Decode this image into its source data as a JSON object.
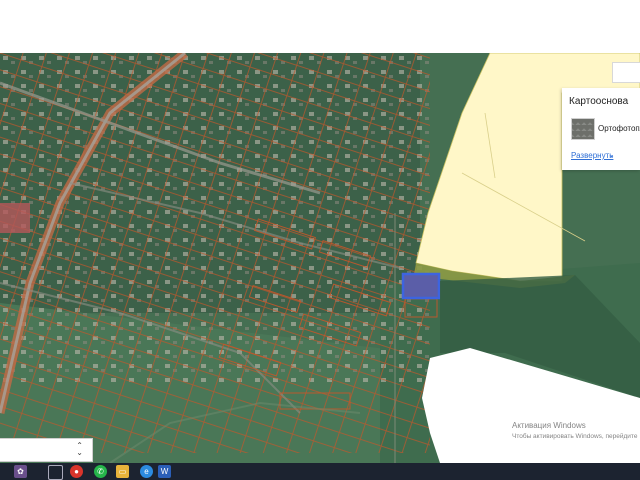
{
  "basemap": {
    "title": "Картооснова",
    "layer_name": "Ортофотопл",
    "expand_label": "Развернуть",
    "chevron": "⌄"
  },
  "zoom_control": {
    "icon": "up-down-arrows-icon",
    "arrows": "⌃\n⌄"
  },
  "watermark": {
    "line1": "Активация Windows",
    "line2": "Чтобы активировать Windows, перейдите"
  },
  "taskbar": {
    "icons": [
      "flower-wallpaper-icon",
      "task-view-icon",
      "chrome-icon",
      "whatsapp-icon",
      "file-explorer-icon",
      "edge-icon",
      "word-icon"
    ]
  },
  "colors": {
    "parcel_outline": "#c6562a",
    "selected_parcel": "#3d64e0",
    "zone_fill": "#fff7c8",
    "map_base": "#3e6a4c",
    "link": "#2f6fd6"
  }
}
